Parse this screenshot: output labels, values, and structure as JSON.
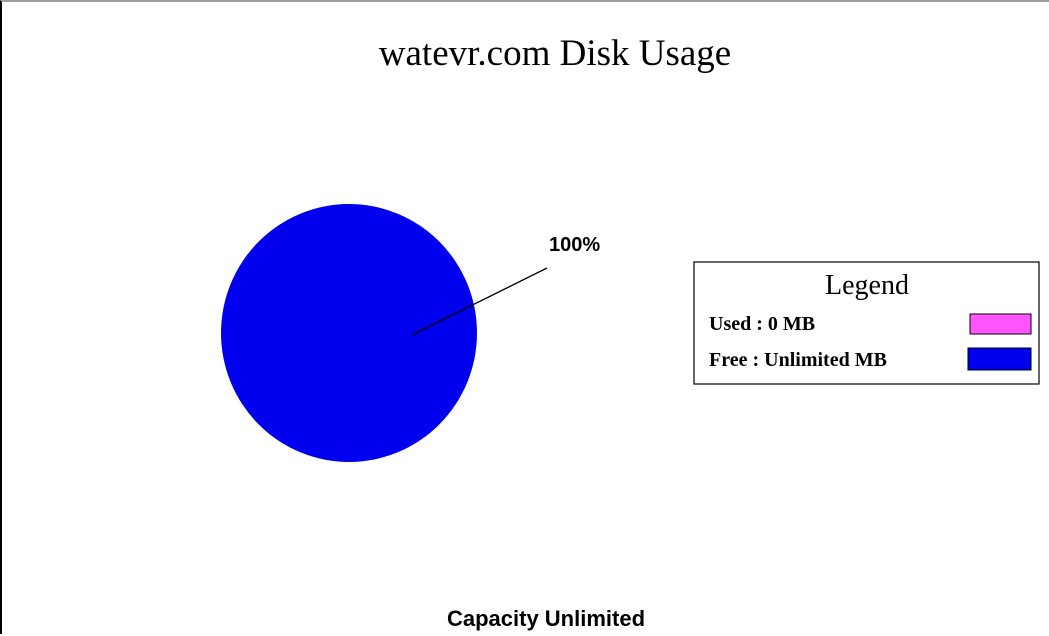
{
  "chart_data": {
    "type": "pie",
    "title": "watevr.com Disk Usage",
    "caption": "Capacity Unlimited",
    "slices": [
      {
        "label": "Used",
        "legend_text": "Used : 0  MB",
        "value": 0,
        "color": "#ff55ff"
      },
      {
        "label": "Free",
        "legend_text": "Free : Unlimited  MB",
        "value": 100,
        "color": "#0000ee"
      }
    ],
    "data_labels": [
      "100%"
    ],
    "legend": {
      "title": "Legend",
      "placement": "right"
    }
  }
}
